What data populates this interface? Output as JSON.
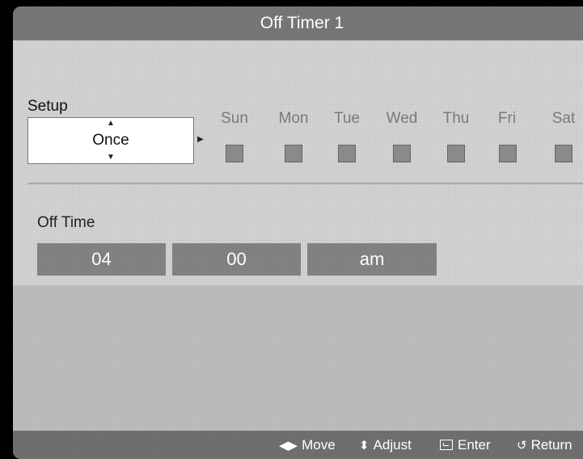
{
  "title": "Off Timer 1",
  "setup": {
    "label": "Setup",
    "value": "Once",
    "up_glyph": "▲",
    "down_glyph": "▼",
    "right_glyph": "▶"
  },
  "days": [
    {
      "label": "Sun"
    },
    {
      "label": "Mon"
    },
    {
      "label": "Tue"
    },
    {
      "label": "Wed"
    },
    {
      "label": "Thu"
    },
    {
      "label": "Fri"
    },
    {
      "label": "Sat"
    }
  ],
  "off_time": {
    "label": "Off Time",
    "hour": "04",
    "minute": "00",
    "ampm": "am"
  },
  "hints": {
    "move_icon": "◀▶",
    "move": "Move",
    "adjust_icon": "⬍",
    "adjust": "Adjust",
    "enter": "Enter",
    "return_icon": "↺",
    "return": "Return"
  },
  "colors": {
    "title_bar": "#737373",
    "panel": "#d2d2d2",
    "time_field": "#7f7f7f",
    "day_label": "#7a7a7a"
  }
}
